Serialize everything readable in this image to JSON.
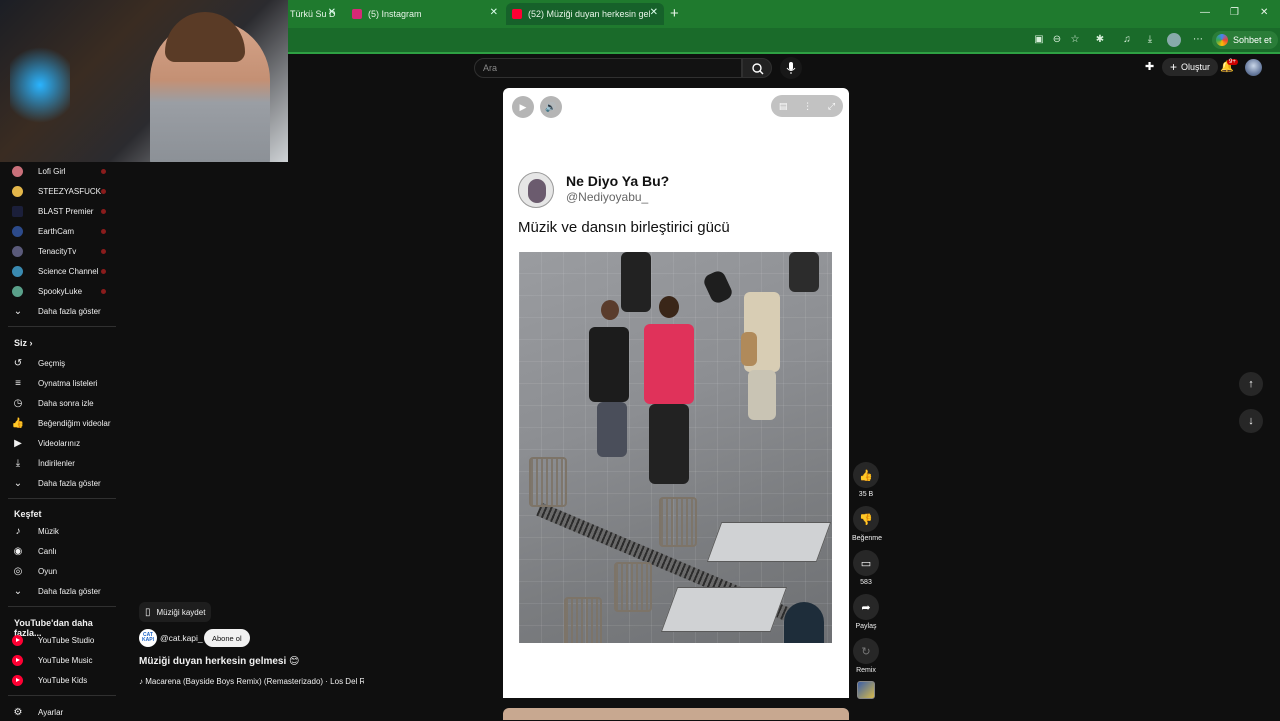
{
  "browser": {
    "tabs": [
      {
        "title": "Türkü Su D",
        "favicon_color": "#2f7d3a"
      },
      {
        "title": "(5) Instagram",
        "favicon_color": "#d62976"
      },
      {
        "title": "(52) Müziği duyan herkesin gelme",
        "favicon_color": "#ff0033"
      }
    ],
    "chat_button_label": "Sohbet et",
    "accent_color": "#1f7a2e"
  },
  "youtube": {
    "search_placeholder": "Ara",
    "create_label": "Oluştur",
    "notification_count": "9+"
  },
  "sidebar": {
    "subscriptions": [
      {
        "label": "Lofi Girl",
        "color": "#c9707a"
      },
      {
        "label": "STEEZYASFUCK",
        "color": "#e3b64a"
      },
      {
        "label": "BLAST Premier",
        "color": "#1b1f3a"
      },
      {
        "label": "EarthCam",
        "color": "#2c4a8a"
      },
      {
        "label": "TenacityTv",
        "color": "#5a5a7a"
      },
      {
        "label": "Science Channel",
        "color": "#3a8ab0"
      },
      {
        "label": "SpookyLuke",
        "color": "#5aa08a"
      }
    ],
    "show_more_1": "Daha fazla göster",
    "you_heading": "Siz",
    "you_items": [
      "Geçmiş",
      "Oynatma listeleri",
      "Daha sonra izle",
      "Beğendiğim videolar",
      "Videolarınız",
      "İndirilenler"
    ],
    "show_more_2": "Daha fazla göster",
    "explore_heading": "Keşfet",
    "explore_items": [
      "Müzik",
      "Canlı",
      "Oyun"
    ],
    "show_more_3": "Daha fazla göster",
    "more_heading": "YouTube'dan daha fazla...",
    "more_items": [
      "YouTube Studio",
      "YouTube Music",
      "YouTube Kids"
    ],
    "settings_label": "Ayarlar"
  },
  "short": {
    "author_name": "Ne Diyo Ya Bu?",
    "author_handle": "@Nediyoyabu_",
    "post_text": "Müzik ve dansın birleştirici gücü"
  },
  "actions": {
    "like_count": "35 B",
    "dislike_label": "Beğenme",
    "comment_count": "583",
    "share_label": "Paylaş",
    "remix_label": "Remix"
  },
  "video_meta": {
    "save_music_label": "Müziği kaydet",
    "channel_avatar_text": "CAT KAPI",
    "channel_name": "@cat.kapi_",
    "subscribe_label": "Abone ol",
    "title": "Müziği duyan herkesin gelmesi 😊",
    "music": "♪ Macarena (Bayside Boys Remix) (Remasterizado) · Los Del R"
  }
}
